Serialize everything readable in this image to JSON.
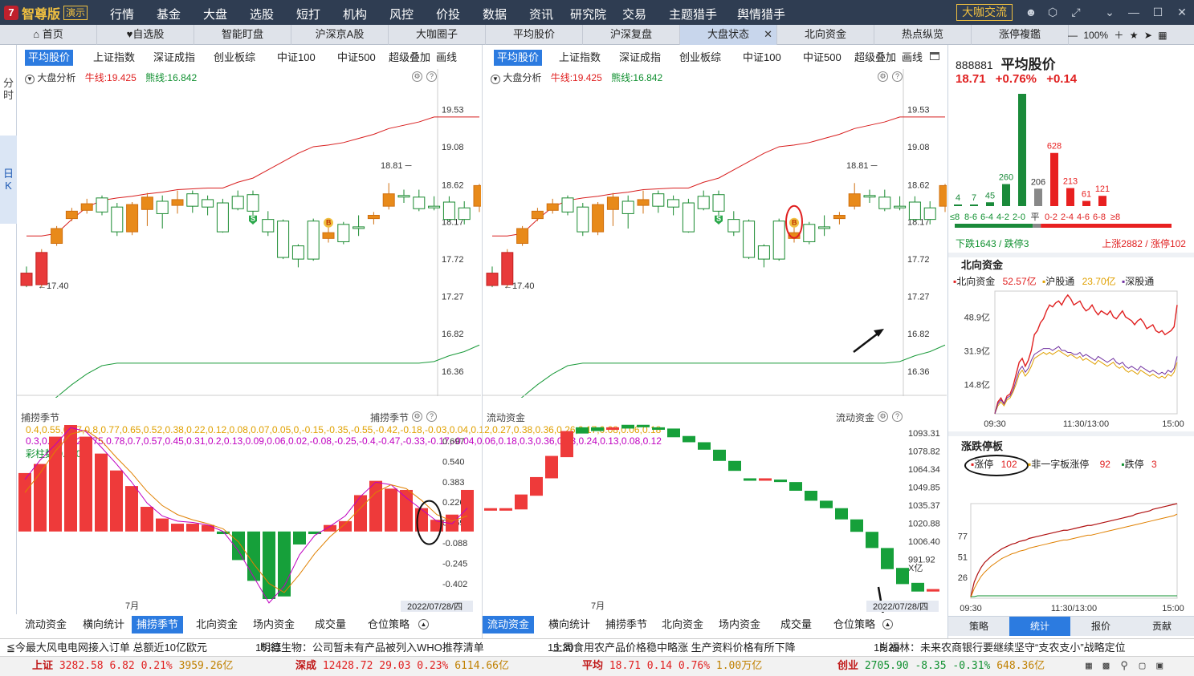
{
  "app": {
    "brand": "智尊版",
    "demo_badge": "演示",
    "logo_glyph": "7",
    "big_cafe": "大咖交流"
  },
  "menu": [
    "行情",
    "基金",
    "大盘",
    "选股",
    "短打",
    "机构",
    "风控",
    "价投",
    "数据",
    "资讯",
    "研究院",
    "交易",
    "主题猎手",
    "舆情猎手"
  ],
  "tabs": [
    "首页",
    "自选股",
    "智能盯盘",
    "沪深京A股",
    "大咖圈子",
    "平均股价",
    "沪深复盘",
    "大盘状态",
    "北向资金",
    "热点纵览",
    "涨停複鑑"
  ],
  "tab_icons": {
    "home": "home-icon",
    "fav": "heart-icon"
  },
  "zoom": "100%",
  "left_strip": {
    "fenshi": "分时",
    "daily": "日K"
  },
  "subtabs": [
    "平均股价",
    "上证指数",
    "深证成指",
    "创业板综",
    "中证100",
    "中证500",
    "超级叠加",
    "画线"
  ],
  "chart_info": {
    "label": "大盘分析",
    "bull": "牛线:19.425",
    "bear": "熊线:16.842"
  },
  "price_axis": [
    "19.53",
    "19.08",
    "18.62",
    "18.17",
    "17.72",
    "17.27",
    "16.82",
    "16.36"
  ],
  "price_hi": "18.81",
  "price_lo": "17.40",
  "candles": [
    [
      17.55,
      17.4,
      17.63,
      17.38
    ],
    [
      17.41,
      17.8,
      17.84,
      17.38
    ],
    [
      17.91,
      18.09,
      18.12,
      17.88
    ],
    [
      18.21,
      18.3,
      18.34,
      18.18
    ],
    [
      18.31,
      18.39,
      18.45,
      18.27
    ],
    [
      18.46,
      18.29,
      18.49,
      18.25
    ],
    [
      18.35,
      18.05,
      18.4,
      18.0
    ],
    [
      18.05,
      18.38,
      18.41,
      18.01
    ],
    [
      18.32,
      18.47,
      18.52,
      18.12
    ],
    [
      18.42,
      18.27,
      18.49,
      18.09
    ],
    [
      18.37,
      18.44,
      18.55,
      18.27
    ],
    [
      18.51,
      18.36,
      18.55,
      18.28
    ],
    [
      18.44,
      18.35,
      18.49,
      18.25
    ],
    [
      18.4,
      18.05,
      18.45,
      18.04
    ],
    [
      18.48,
      18.33,
      18.55,
      18.31
    ],
    [
      18.5,
      18.3,
      18.55,
      18.14
    ],
    [
      18.2,
      18.05,
      18.3,
      18.0
    ],
    [
      18.18,
      17.74,
      18.2,
      17.72
    ],
    [
      17.88,
      17.72,
      17.9,
      17.62
    ],
    [
      18.18,
      17.72,
      18.21,
      17.7
    ],
    [
      17.97,
      18.04,
      18.12,
      17.92
    ],
    [
      18.14,
      17.93,
      18.17,
      17.9
    ],
    [
      18.11,
      18.1,
      18.25,
      18.0
    ],
    [
      18.21,
      18.25,
      18.29,
      18.14
    ],
    [
      18.36,
      18.51,
      18.64,
      18.32
    ],
    [
      18.49,
      18.48,
      18.56,
      18.4
    ],
    [
      18.47,
      18.33,
      18.56,
      18.3
    ],
    [
      18.36,
      18.35,
      18.48,
      18.31
    ],
    [
      18.41,
      18.2,
      18.48,
      18.18
    ],
    [
      18.34,
      18.2,
      18.42,
      18.14
    ],
    [
      18.36,
      18.61,
      18.63,
      18.29
    ],
    [
      18.58,
      18.71,
      18.82,
      18.55
    ]
  ],
  "markers": {
    "sell_label": "S",
    "buy_label": "B"
  },
  "bull_line": [
    18.0,
    18.0,
    18.03,
    18.2,
    18.35,
    18.43,
    18.46,
    18.48,
    18.51,
    18.53,
    18.56,
    18.57,
    18.58,
    18.58,
    18.65,
    18.7,
    18.8,
    18.9,
    19.0,
    19.08,
    19.1,
    19.13,
    19.18,
    19.23,
    19.3,
    19.34,
    19.38,
    19.44,
    19.44,
    19.44,
    19.44
  ],
  "bear_line": [
    15.85,
    15.9,
    16.05,
    16.2,
    16.33,
    16.43,
    16.46,
    16.46,
    16.46,
    16.46,
    16.46,
    16.46,
    16.46,
    16.46,
    16.46,
    16.46,
    16.46,
    16.46,
    16.46,
    16.46,
    16.46,
    16.46,
    16.46,
    16.46,
    16.46,
    16.46,
    16.46,
    16.48,
    16.55,
    16.6,
    16.68
  ],
  "dots_colors": [
    "#e83a3a",
    "#f0e040",
    "#f0e040",
    "#f0e040",
    "#e83a3a",
    "#f0e040",
    "#f0e040",
    "#f0e040",
    "#f0e040",
    "#f0e040",
    "#f0e040",
    "#f0e040",
    "#f0e040",
    "#f0e040",
    "#f0e040",
    "#f0e040",
    "#f0e040",
    "#999999",
    "#999999",
    "#999999",
    "#999999",
    "#999999",
    "#999999",
    "#999999",
    "#f0e040",
    "#f0e040",
    "#f0e040",
    "#f0e040",
    "#f0e040",
    "#f0e040",
    "#f0e040",
    "#f0e040",
    "#f0e040"
  ],
  "season": {
    "title": "捕捞季节",
    "x1": [
      0.4,
      0.55,
      0.67,
      0.8,
      0.77,
      0.65,
      0.52,
      0.38,
      0.22,
      0.12,
      0.08,
      0.07,
      0.05,
      0.0,
      -0.15,
      -0.35,
      -0.55,
      -0.42,
      -0.18,
      -0.03,
      0.04,
      0.12,
      0.27,
      0.38,
      0.36,
      0.26,
      0.17,
      0.08,
      0.06,
      0.18
    ],
    "x2": [
      0.3,
      0.45,
      0.62,
      0.75,
      0.78,
      0.7,
      0.57,
      0.45,
      0.31,
      0.2,
      0.13,
      0.09,
      0.06,
      0.02,
      -0.08,
      -0.25,
      -0.4,
      -0.47,
      -0.33,
      -0.17,
      -0.04,
      0.06,
      0.18,
      0.3,
      0.36,
      0.33,
      0.24,
      0.13,
      0.08,
      0.12
    ],
    "cz": "彩柱数:0.000",
    "axis": [
      "0.697",
      "0.540",
      "0.383",
      "0.226",
      "0.069",
      "-0.088",
      "-0.245",
      "-0.402"
    ],
    "bars": [
      0.45,
      0.52,
      0.73,
      0.82,
      0.73,
      0.6,
      0.47,
      0.35,
      0.19,
      0.1,
      0.06,
      0.06,
      0.05,
      -0.02,
      -0.22,
      -0.38,
      -0.52,
      -0.5,
      -0.1,
      -0.02,
      0.05,
      0.08,
      0.28,
      0.39,
      0.33,
      0.32,
      0.18,
      0.09,
      0.13,
      0.32
    ]
  },
  "liquidity": {
    "title": "流动资金",
    "unit": "X亿",
    "axis": [
      "1093.31",
      "1078.82",
      "1064.34",
      "1049.85",
      "1035.37",
      "1020.88",
      "1006.40",
      "991.92"
    ],
    "blocks": [
      [
        1031,
        1033
      ],
      [
        1031,
        1033
      ],
      [
        1032,
        1044
      ],
      [
        1043,
        1058
      ],
      [
        1057,
        1075
      ],
      [
        1074,
        1095
      ],
      [
        1093,
        1098
      ],
      [
        1095,
        1098
      ],
      [
        1096,
        1098
      ],
      [
        1097,
        1100
      ],
      [
        1098,
        1100
      ],
      [
        1096,
        1098
      ],
      [
        1090,
        1097
      ],
      [
        1086,
        1091
      ],
      [
        1080,
        1086
      ],
      [
        1071,
        1080
      ],
      [
        1063,
        1071
      ],
      [
        1056,
        1057
      ],
      [
        1056,
        1057
      ],
      [
        1054,
        1056
      ],
      [
        1047,
        1054
      ],
      [
        1039,
        1047
      ],
      [
        1033,
        1039
      ],
      [
        1024,
        1033
      ],
      [
        1014,
        1024
      ],
      [
        1001,
        1014
      ],
      [
        984,
        1001
      ],
      [
        972,
        985
      ],
      [
        966,
        973
      ],
      [
        966,
        968
      ]
    ],
    "block_colors": [
      "r",
      "r",
      "r",
      "r",
      "r",
      "r",
      "g",
      "g",
      "r",
      "g",
      "g",
      "g",
      "g",
      "g",
      "g",
      "g",
      "g",
      "g",
      "r",
      "g",
      "g",
      "g",
      "g",
      "g",
      "g",
      "g",
      "g",
      "g",
      "g",
      "r"
    ]
  },
  "date_label": "2022/07/28/四",
  "month_label": "7月",
  "bottom_tabs": [
    "流动资金",
    "横向统计",
    "捕捞季节",
    "北向资金",
    "场内资金",
    "成交量",
    "仓位策略"
  ],
  "quote": {
    "code": "888881",
    "name": "平均股价",
    "price": "18.71",
    "pct": "+0.76%",
    "chg": "+0.14"
  },
  "dist": {
    "values": [
      "4",
      "7",
      "45",
      "260",
      "1327",
      "206",
      "628",
      "213",
      "61",
      "121"
    ],
    "num": [
      4,
      7,
      45,
      260,
      1327,
      206,
      628,
      213,
      61,
      121
    ],
    "colors": [
      "#1a8a3a",
      "#1a8a3a",
      "#1a8a3a",
      "#1a8a3a",
      "#1a8a3a",
      "#888888",
      "#e82020",
      "#e82020",
      "#e82020",
      "#e82020"
    ],
    "labels": [
      "≤8",
      "8-6",
      "6-4",
      "4-2",
      "2-0",
      "平",
      "0-2",
      "2-4",
      "4-6",
      "6-8",
      "≥8"
    ],
    "down": "下跌1643 / 跌停3",
    "up": "上涨2882 / 涨停102",
    "down_frac": 0.36
  },
  "north": {
    "title": "北向资金",
    "l1": "北向资金",
    "v1": "52.57亿",
    "l2": "沪股通",
    "v2": "23.70亿",
    "l3": "深股通",
    "axis": [
      "48.9亿",
      "31.9亿",
      "14.8亿"
    ],
    "times": [
      "09:30",
      "11:30/13:00",
      "15:00"
    ],
    "s1": [
      0,
      6,
      8,
      5,
      9,
      10,
      14,
      20,
      26,
      28,
      24,
      27,
      32,
      40,
      42,
      46,
      48,
      52,
      55,
      54,
      56,
      57,
      55,
      58,
      60,
      58,
      55,
      56,
      57,
      54,
      52,
      53,
      55,
      52,
      50,
      52,
      51,
      50,
      52,
      49,
      48,
      50,
      52,
      49,
      48,
      47,
      45,
      47,
      48,
      46,
      43,
      44,
      45,
      42,
      41,
      42,
      40,
      41,
      42,
      44,
      55
    ],
    "s2": [
      0,
      4,
      6,
      4,
      7,
      8,
      11,
      15,
      20,
      22,
      19,
      21,
      24,
      28,
      29,
      30,
      31,
      30,
      31,
      30,
      31,
      32,
      31,
      30,
      29,
      30,
      29,
      28,
      29,
      27,
      28,
      27,
      26,
      25,
      27,
      26,
      25,
      24,
      25,
      26,
      24,
      23,
      24,
      22,
      21,
      22,
      21,
      20,
      22,
      21,
      20,
      19,
      20,
      19,
      18,
      19,
      18,
      20,
      19,
      21,
      26
    ],
    "s3": [
      0,
      5,
      7,
      5,
      8,
      9,
      12,
      17,
      22,
      24,
      21,
      23,
      27,
      30,
      31,
      32,
      33,
      33,
      33,
      32,
      33,
      34,
      32,
      32,
      31,
      31,
      30,
      30,
      31,
      29,
      30,
      29,
      28,
      27,
      29,
      28,
      27,
      26,
      27,
      28,
      26,
      25,
      26,
      24,
      23,
      24,
      23,
      22,
      24,
      23,
      22,
      21,
      22,
      21,
      20,
      21,
      20,
      22,
      21,
      23,
      29
    ]
  },
  "limit": {
    "title": "涨跌停板",
    "l1": "涨停",
    "v1": "102",
    "l2": "非一字板涨停",
    "v2": "92",
    "l3": "跌停",
    "v3": "3",
    "axis": [
      "77",
      "51",
      "26"
    ],
    "times": [
      "09:30",
      "11:30/13:00",
      "15:00"
    ],
    "up": [
      2,
      20,
      30,
      38,
      44,
      48,
      52,
      55,
      58,
      61,
      63,
      65,
      67,
      68,
      70,
      71,
      72,
      74,
      75,
      76,
      77,
      78,
      79,
      80,
      81,
      82,
      83,
      84,
      84,
      85,
      86,
      87,
      88,
      89,
      90,
      90,
      91,
      92,
      93,
      94,
      95,
      96,
      97,
      98,
      99,
      100,
      101,
      102,
      104,
      105,
      106,
      107,
      108,
      110,
      111,
      112,
      113,
      114,
      115,
      116,
      117
    ],
    "nyz": [
      1,
      12,
      20,
      27,
      32,
      36,
      40,
      43,
      46,
      49,
      51,
      53,
      55,
      56,
      58,
      59,
      60,
      62,
      63,
      64,
      65,
      66,
      67,
      68,
      69,
      70,
      71,
      72,
      72,
      73,
      74,
      75,
      76,
      77,
      78,
      78,
      79,
      80,
      81,
      82,
      83,
      84,
      85,
      86,
      87,
      88,
      89,
      90,
      91,
      92,
      93,
      94,
      95,
      96,
      97,
      98,
      99,
      100,
      101,
      102,
      104
    ],
    "down": [
      2,
      2,
      3,
      3,
      3,
      3,
      3,
      3,
      3,
      3,
      3,
      3,
      3,
      3,
      3,
      3,
      3,
      3,
      3,
      3,
      3,
      3,
      3,
      3,
      3,
      3,
      3,
      3,
      3,
      3,
      3,
      3,
      3,
      3,
      3,
      3,
      3,
      3,
      3,
      3,
      3,
      3,
      3,
      3,
      3,
      3,
      3,
      3,
      3,
      3,
      3,
      3,
      3,
      3,
      3,
      3,
      3,
      3,
      3,
      3,
      3
    ]
  },
  "right_tabs": [
    "策略",
    "统计",
    "报价",
    "贡献"
  ],
  "ticker": [
    {
      "time": "",
      "text": "≦今最大风电电网接入订单 总额近10亿欧元"
    },
    {
      "time": "15:31",
      "text": "明德生物：公司暂未有产品被列入WHO推荐清单"
    },
    {
      "time": "15:30",
      "text": "上周食用农产品价格稳中略涨 生产资料价格有所下降"
    },
    {
      "time": "15:29",
      "text": "肖福林：未来农商银行要继续坚守“支农支小”战略定位"
    }
  ],
  "indices": [
    {
      "name": "上证",
      "vals": "3282.58 6.82 0.21%",
      "amt": "3959.26亿",
      "dir": "up"
    },
    {
      "name": "深成",
      "vals": "12428.72 29.03 0.23%",
      "amt": "6114.66亿",
      "dir": "up"
    },
    {
      "name": "平均",
      "vals": "18.71 0.14 0.76%",
      "amt": "1.00万亿",
      "dir": "up"
    },
    {
      "name": "创业",
      "vals": "2705.90 -8.35 -0.31%",
      "amt": "648.36亿",
      "dir": "down"
    }
  ]
}
